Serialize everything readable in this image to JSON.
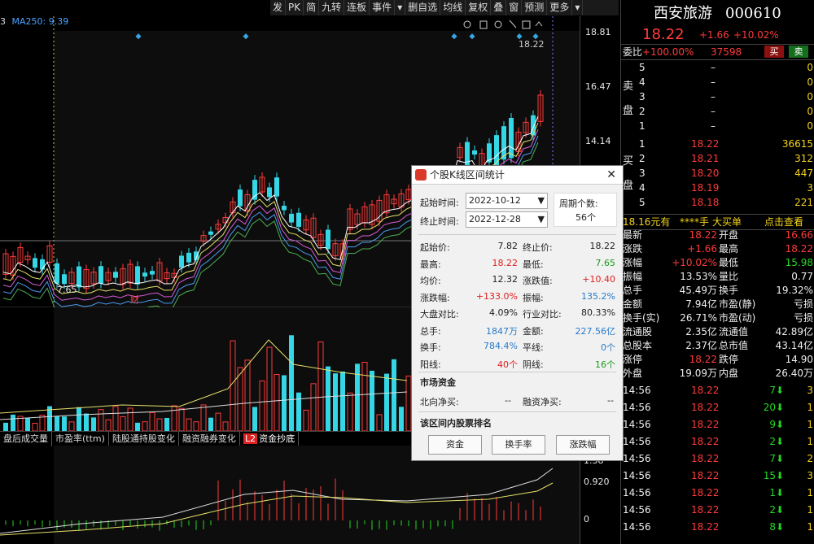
{
  "toolbar": {
    "items": [
      "发",
      "PK",
      "简",
      "九转",
      "连板",
      "事件",
      "▾",
      "删自选",
      "均线",
      "复权",
      "叠",
      "窗",
      "预测",
      "更多",
      "▾"
    ]
  },
  "chart_header": {
    "ma_label": "MA250: 9.39",
    "left_num": "3"
  },
  "price_axis": {
    "labels": [
      "18.81",
      "16.47",
      "14.14"
    ],
    "high_marker": "18.22",
    "low_marker": "7.65",
    "cai_marker": "财"
  },
  "macd_axis": {
    "labels": [
      "1.38",
      "0.920",
      "0"
    ]
  },
  "tabs": [
    "盘后成交量",
    "市盈率(ttm)",
    "陆股通持股变化",
    "融资融券变化",
    "资金抄底"
  ],
  "tab_l2": "L2",
  "stock": {
    "name": "西安旅游",
    "code": "000610",
    "price": "18.22",
    "change": "+1.66",
    "pct": "+10.02%"
  },
  "order_book": {
    "webi_label": "委比",
    "webi_val": "+100.00%",
    "weicha_val": "37598",
    "buy_btn": "买",
    "sell_btn": "卖",
    "sell_side_label": "卖盘",
    "sells": [
      [
        "5",
        "–",
        "0"
      ],
      [
        "4",
        "–",
        "0"
      ],
      [
        "3",
        "–",
        "0"
      ],
      [
        "2",
        "–",
        "0"
      ],
      [
        "1",
        "–",
        "0"
      ]
    ],
    "buy_side_label": "买盘",
    "buys": [
      [
        "1",
        "18.22",
        "36615"
      ],
      [
        "2",
        "18.21",
        "312"
      ],
      [
        "3",
        "18.20",
        "447"
      ],
      [
        "4",
        "18.19",
        "3"
      ],
      [
        "5",
        "18.18",
        "221"
      ]
    ]
  },
  "news_line": {
    "left": "18.16元有",
    "mid": "****手",
    "right": "大买单",
    "link": "点击查看"
  },
  "stats": [
    [
      "最新",
      "18.22",
      "开盘",
      "16.66"
    ],
    [
      "涨跌",
      "+1.66",
      "最高",
      "18.22"
    ],
    [
      "涨幅",
      "+10.02%",
      "最低",
      "15.98"
    ],
    [
      "振幅",
      "13.53%",
      "量比",
      "0.77"
    ],
    [
      "总手",
      "45.49万",
      "换手",
      "19.32%"
    ],
    [
      "金额",
      "7.94亿",
      "市盈(静)",
      "亏损"
    ],
    [
      "换手(实)",
      "26.71%",
      "市盈(动)",
      "亏损"
    ],
    [
      "流通股",
      "2.35亿",
      "流通值",
      "42.89亿"
    ],
    [
      "总股本",
      "2.37亿",
      "总市值",
      "43.14亿"
    ],
    [
      "涨停",
      "18.22",
      "跌停",
      "14.90"
    ],
    [
      "外盘",
      "19.09万",
      "内盘",
      "26.40万"
    ]
  ],
  "ticks": [
    [
      "14:56",
      "18.22",
      "7",
      "3"
    ],
    [
      "14:56",
      "18.22",
      "20",
      "1"
    ],
    [
      "14:56",
      "18.22",
      "9",
      "1"
    ],
    [
      "14:56",
      "18.22",
      "2",
      "1"
    ],
    [
      "14:56",
      "18.22",
      "7",
      "2"
    ],
    [
      "14:56",
      "18.22",
      "15",
      "3"
    ],
    [
      "14:56",
      "18.22",
      "1",
      "1"
    ],
    [
      "14:56",
      "18.22",
      "2",
      "1"
    ],
    [
      "14:56",
      "18.22",
      "8",
      "1"
    ]
  ],
  "dialog": {
    "title": "个股K线区间统计",
    "close": "✕",
    "start_label": "起始时间:",
    "start_date": "2022-10-12",
    "end_label": "终止时间:",
    "end_date": "2022-12-28",
    "period_label": "周期个数:",
    "period_val": "56个",
    "rows": [
      [
        "起始价:",
        "7.82",
        "终止价:",
        "18.22"
      ],
      [
        "最高:",
        "18.22",
        "最低:",
        "7.65"
      ],
      [
        "均价:",
        "12.32",
        "涨跌值:",
        "+10.40"
      ],
      [
        "涨跌幅:",
        "+133.0%",
        "振幅:",
        "135.2%"
      ],
      [
        "大盘对比:",
        "4.09%",
        "行业对比:",
        "80.33%"
      ],
      [
        "总手:",
        "1847万",
        "金额:",
        "227.56亿"
      ],
      [
        "换手:",
        "784.4%",
        "平线:",
        "0个"
      ],
      [
        "阳线:",
        "40个",
        "阴线:",
        "16个"
      ]
    ],
    "fund_title": "市场资金",
    "north_label": "北向净买:",
    "north_val": "--",
    "margin_label": "融资净买:",
    "margin_val": "--",
    "rank_title": "该区间内股票排名",
    "btn_fund": "资金",
    "btn_turnover": "换手率",
    "btn_pct": "涨跌幅"
  },
  "colors": {
    "up": "#ff3b3b",
    "down": "#35d6e6",
    "bg": "#000000"
  }
}
